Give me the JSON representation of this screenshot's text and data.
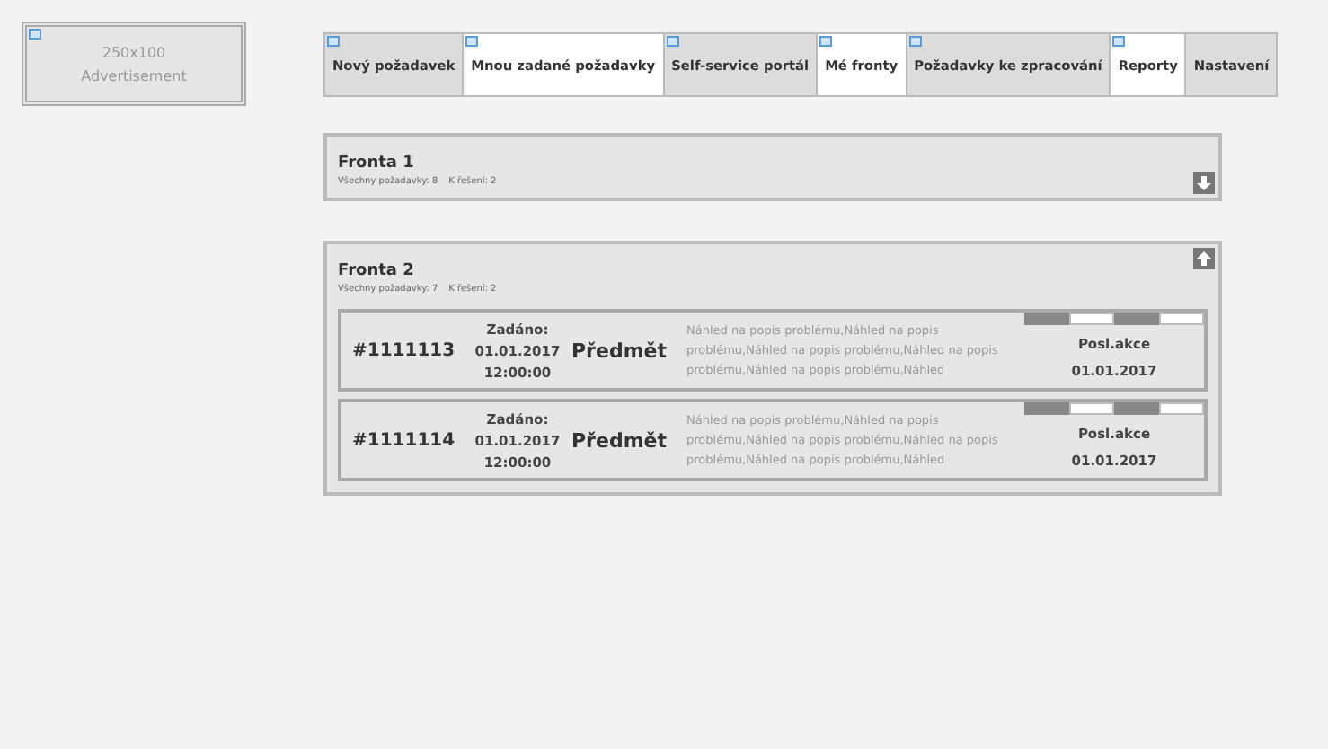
{
  "advertisement": {
    "size": "250x100",
    "label": "Advertisement"
  },
  "tabs": [
    {
      "label": "Nový požadavek",
      "selected": false,
      "icon": true
    },
    {
      "label": "Mnou zadané požadavky",
      "selected": true,
      "icon": true
    },
    {
      "label": "Self-service portál",
      "selected": false,
      "icon": true
    },
    {
      "label": "Mé fronty",
      "selected": true,
      "icon": true
    },
    {
      "label": "Požadavky ke zpracování",
      "selected": false,
      "icon": true
    },
    {
      "label": "Reporty",
      "selected": true,
      "icon": true
    },
    {
      "label": "Nastavení",
      "selected": false,
      "icon": false
    }
  ],
  "queues": [
    {
      "title": "Fronta 1",
      "stats": "Všechny požadavky: 8",
      "to_solve": "K řešení: 2",
      "expanded": false
    },
    {
      "title": "Fronta 2",
      "stats": "Všechny požadavky: 7",
      "to_solve": "K řešení: 2",
      "expanded": true,
      "requests": [
        {
          "id": "#1111113",
          "created_label": "Zadáno:",
          "date": "01.01.2017",
          "time": "12:00:00",
          "subject": "Předmět",
          "preview": "Náhled na popis problému,Náhled na popis problému,Náhled na popis problému,Náhled na popis problému,Náhled na popis problému,Náhled",
          "last_action": "Posl.akce",
          "last_date": "01.01.2017"
        },
        {
          "id": "#1111114",
          "created_label": "Zadáno:",
          "date": "01.01.2017",
          "time": "12:00:00",
          "subject": "Předmět",
          "preview": "Náhled na popis problému,Náhled na popis problému,Náhled na popis problému,Náhled na popis problému,Náhled na popis problému,Náhled",
          "last_action": "Posl.akce",
          "last_date": "01.01.2017"
        }
      ]
    }
  ]
}
